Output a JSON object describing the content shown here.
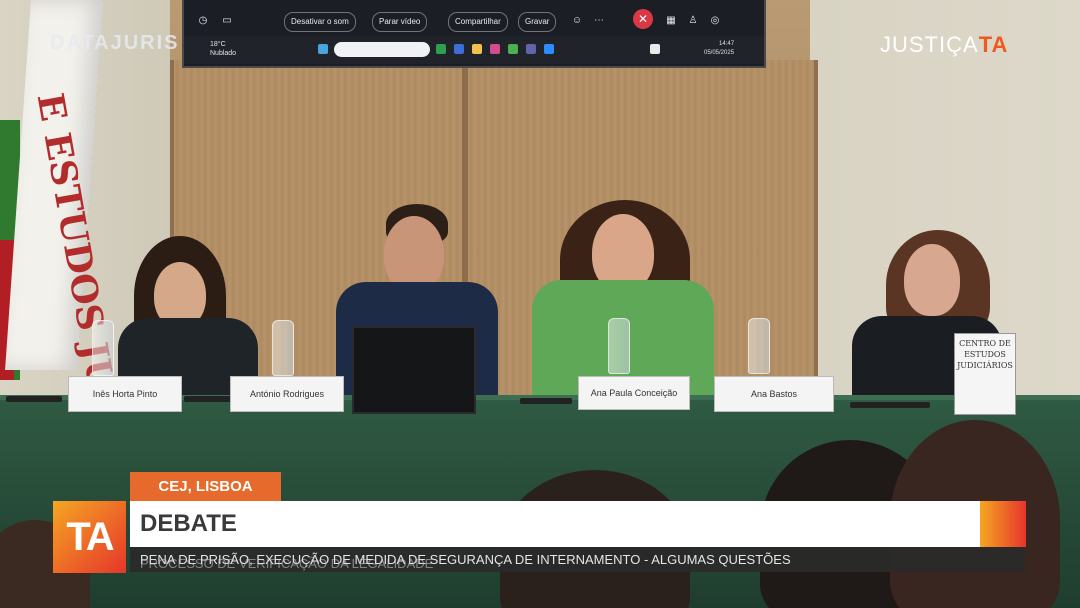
{
  "screen": {
    "buttons": [
      "Desativar o som",
      "Parar vídeo",
      "Compartilhar",
      "Gravar"
    ],
    "weather": {
      "temp": "18°C",
      "condition": "Nublado"
    },
    "clock": {
      "time": "14:47",
      "date": "05/05/2025"
    }
  },
  "overlay": {
    "brand_left": "DATAJURIS",
    "brand_right_prefix": "JUSTIÇA",
    "brand_right_mark": "TA"
  },
  "flag_text": "E ESTUDOS JUDICIÁRIOS",
  "nameplates": [
    "Inês Horta Pinto",
    "António Rodrigues",
    "Ana Paula Conceição",
    "Ana Bastos"
  ],
  "sign": "CENTRO DE ESTUDOS JUDICIÁRIOS",
  "lower_third": {
    "location": "CEJ, LISBOA",
    "logo": "TA",
    "title": "DEBATE",
    "subtitle_primary": "PENA DE PRISÃO, EXECUÇÃO DE MEDIDA DE SEGURANÇA DE INTERNAMENTO - ALGUMAS QUESTÕES",
    "subtitle_secondary": "PROCESSO DE VERIFICAÇÃO DA LEGALIDADE"
  },
  "colors": {
    "accent_orange": "#e66a2c",
    "table_green": "#2f5a43"
  }
}
